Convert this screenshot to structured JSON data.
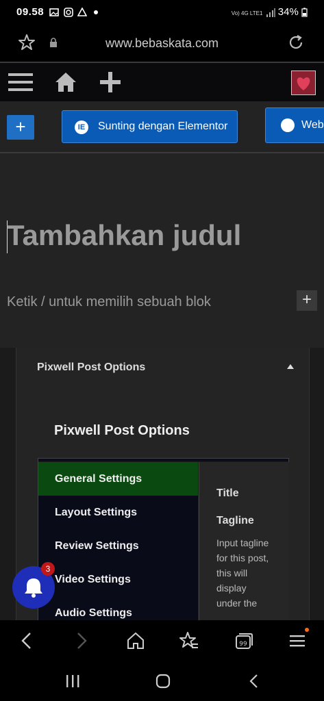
{
  "status_bar": {
    "time": "09.58",
    "notification_icons": [
      "image-icon",
      "instagram-icon",
      "drive-icon",
      "dot-icon"
    ],
    "network_label": "Vo) 4G LTE1",
    "battery_percent": "34%"
  },
  "address_bar": {
    "url": "www.bebaskata.com"
  },
  "wp_toolbar": {
    "icons": [
      "menu-icon",
      "home-icon",
      "plus-icon",
      "avatar"
    ]
  },
  "editor_toolbar": {
    "add_block_symbol": "+",
    "elementor_button_label": "Sunting dengan Elementor",
    "web_button_label": "Web"
  },
  "editor": {
    "title_placeholder": "Tambahkan judul",
    "block_placeholder": "Ketik / untuk memilih sebuah blok",
    "add_block_symbol": "+"
  },
  "metabox": {
    "header_title": "Pixwell Post Options",
    "inner_title": "Pixwell Post Options",
    "tabs": [
      {
        "label": "General Settings",
        "active": true
      },
      {
        "label": "Layout Settings",
        "active": false
      },
      {
        "label": "Review Settings",
        "active": false
      },
      {
        "label": "Video Settings",
        "active": false
      },
      {
        "label": "Audio Settings",
        "active": false
      }
    ],
    "content": {
      "field_title": "Title",
      "field_tagline": "Tagline",
      "tagline_description": "Input tagline for this post, this will display under the"
    }
  },
  "notification_bell": {
    "badge_count": "3"
  },
  "colors": {
    "accent_blue": "#0a5bb5",
    "active_tab_green": "#0a4a10",
    "bell_blue": "#1f2eb8",
    "badge_red": "#c01818"
  }
}
